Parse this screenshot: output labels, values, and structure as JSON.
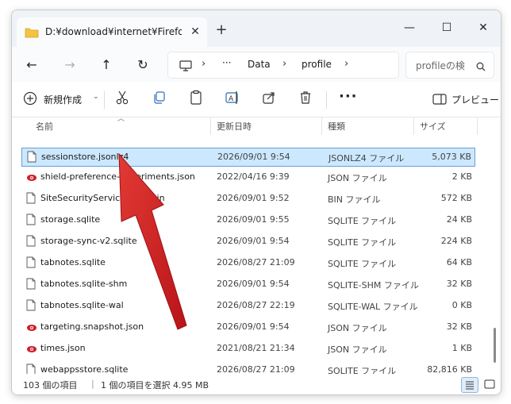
{
  "window": {
    "tab_title": "D:¥download¥internet¥Firefox",
    "controls": {
      "minimize": "—",
      "maximize": "☐",
      "close": "✕"
    }
  },
  "nav": {
    "back": "←",
    "forward": "→",
    "up": "↑",
    "refresh": "↻"
  },
  "address": {
    "ellipsis": "···",
    "segments": [
      "Data",
      "profile"
    ],
    "separator": "›"
  },
  "search": {
    "placeholder": "profileの検索"
  },
  "toolbar": {
    "new_label": "新規作成",
    "new_chevron": "⌄",
    "more": "···",
    "preview_label": "プレビュー"
  },
  "columns": {
    "name": "名前",
    "date": "更新日時",
    "type": "種類",
    "size": "サイズ"
  },
  "files": [
    {
      "name": "sessionstore.jsonlz4",
      "date": "2026/09/01 9:54",
      "type": "JSONLZ4 ファイル",
      "size": "5,073 KB",
      "icon": "file-icon",
      "selected": true
    },
    {
      "name": "shield-preference-experiments.json",
      "date": "2022/04/16 9:39",
      "type": "JSON ファイル",
      "size": "2 KB",
      "icon": "json-icon"
    },
    {
      "name": "SiteSecurityServiceState.bin",
      "date": "2026/09/01 9:52",
      "type": "BIN ファイル",
      "size": "572 KB",
      "icon": "file-icon"
    },
    {
      "name": "storage.sqlite",
      "date": "2026/09/01 9:55",
      "type": "SQLITE ファイル",
      "size": "24 KB",
      "icon": "file-icon"
    },
    {
      "name": "storage-sync-v2.sqlite",
      "date": "2026/09/01 9:54",
      "type": "SQLITE ファイル",
      "size": "224 KB",
      "icon": "file-icon"
    },
    {
      "name": "tabnotes.sqlite",
      "date": "2026/08/27 21:09",
      "type": "SQLITE ファイル",
      "size": "64 KB",
      "icon": "file-icon"
    },
    {
      "name": "tabnotes.sqlite-shm",
      "date": "2026/09/01 9:54",
      "type": "SQLITE-SHM ファイル",
      "size": "32 KB",
      "icon": "file-icon"
    },
    {
      "name": "tabnotes.sqlite-wal",
      "date": "2026/08/27 22:19",
      "type": "SQLITE-WAL ファイル",
      "size": "0 KB",
      "icon": "file-icon"
    },
    {
      "name": "targeting.snapshot.json",
      "date": "2026/09/01 9:54",
      "type": "JSON ファイル",
      "size": "32 KB",
      "icon": "json-icon"
    },
    {
      "name": "times.json",
      "date": "2021/08/21 21:34",
      "type": "JSON ファイル",
      "size": "1 KB",
      "icon": "json-icon"
    },
    {
      "name": "webappsstore.sqlite",
      "date": "2026/08/27 21:09",
      "type": "SQLITE ファイル",
      "size": "82,816 KB",
      "icon": "file-icon"
    }
  ],
  "status": {
    "item_count": "103 個の項目",
    "selection": "1 個の項目を選択  4.95 MB"
  },
  "colors": {
    "selection_bg": "#cce8ff",
    "selection_border": "#6a9fd4",
    "json_icon": "#d0202a",
    "arrow": "#d42020",
    "folder": "#f4c342"
  }
}
